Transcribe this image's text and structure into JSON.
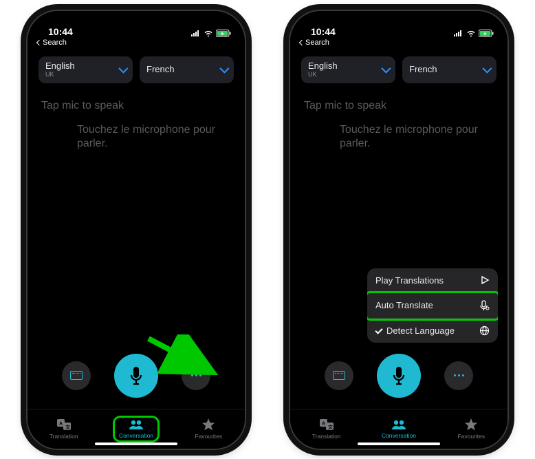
{
  "status": {
    "time": "10:44",
    "search_back": "Search"
  },
  "lang": [
    {
      "main": "English",
      "sub": "UK"
    },
    {
      "main": "French",
      "sub": ""
    }
  ],
  "prompts": {
    "p1": "Tap mic to speak",
    "p2": "Touchez le microphone pour parler."
  },
  "menu": {
    "play": "Play Translations",
    "auto": "Auto Translate",
    "detect": "Detect Language"
  },
  "tabs": {
    "translation": "Translation",
    "conversation": "Conversation",
    "favourites": "Favourites"
  }
}
